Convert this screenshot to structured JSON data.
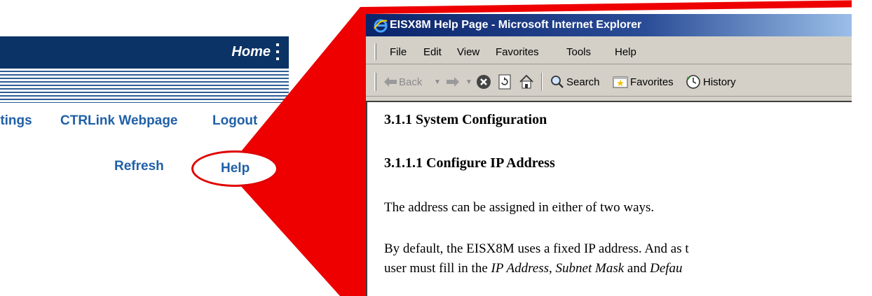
{
  "device_ui": {
    "home_label": "Home",
    "nav": {
      "settings": "ttings",
      "ctrlink": "CTRLink Webpage",
      "logout": "Logout",
      "refresh": "Refresh",
      "help": "Help"
    },
    "colors": {
      "header": "#0c3366",
      "link": "#2060a8",
      "highlight": "#e00000"
    }
  },
  "browser": {
    "title": "EISX8M Help Page - Microsoft Internet Explorer",
    "menu": [
      "File",
      "Edit",
      "View",
      "Favorites",
      "Tools",
      "Help"
    ],
    "toolbar": {
      "back": "Back",
      "search": "Search",
      "favorites": "Favorites",
      "history": "History"
    },
    "icons": [
      "ie-icon",
      "back-arrow-icon",
      "forward-arrow-icon",
      "stop-icon",
      "refresh-icon",
      "home-icon",
      "search-icon",
      "favorites-icon",
      "history-icon"
    ],
    "content": {
      "heading1": "3.1.1 System Configuration",
      "heading2": "3.1.1.1 Configure IP Address",
      "para1": "The address can be assigned in either of two ways.",
      "para2_line1": "By default, the EISX8M uses a fixed IP address. And as t",
      "para2_line2_start": "user must fill in the ",
      "para2_ip": "IP Address",
      "para2_comma": ", ",
      "para2_subnet": "Subnet Mask",
      "para2_and": " and ",
      "para2_default": "Defau"
    }
  }
}
